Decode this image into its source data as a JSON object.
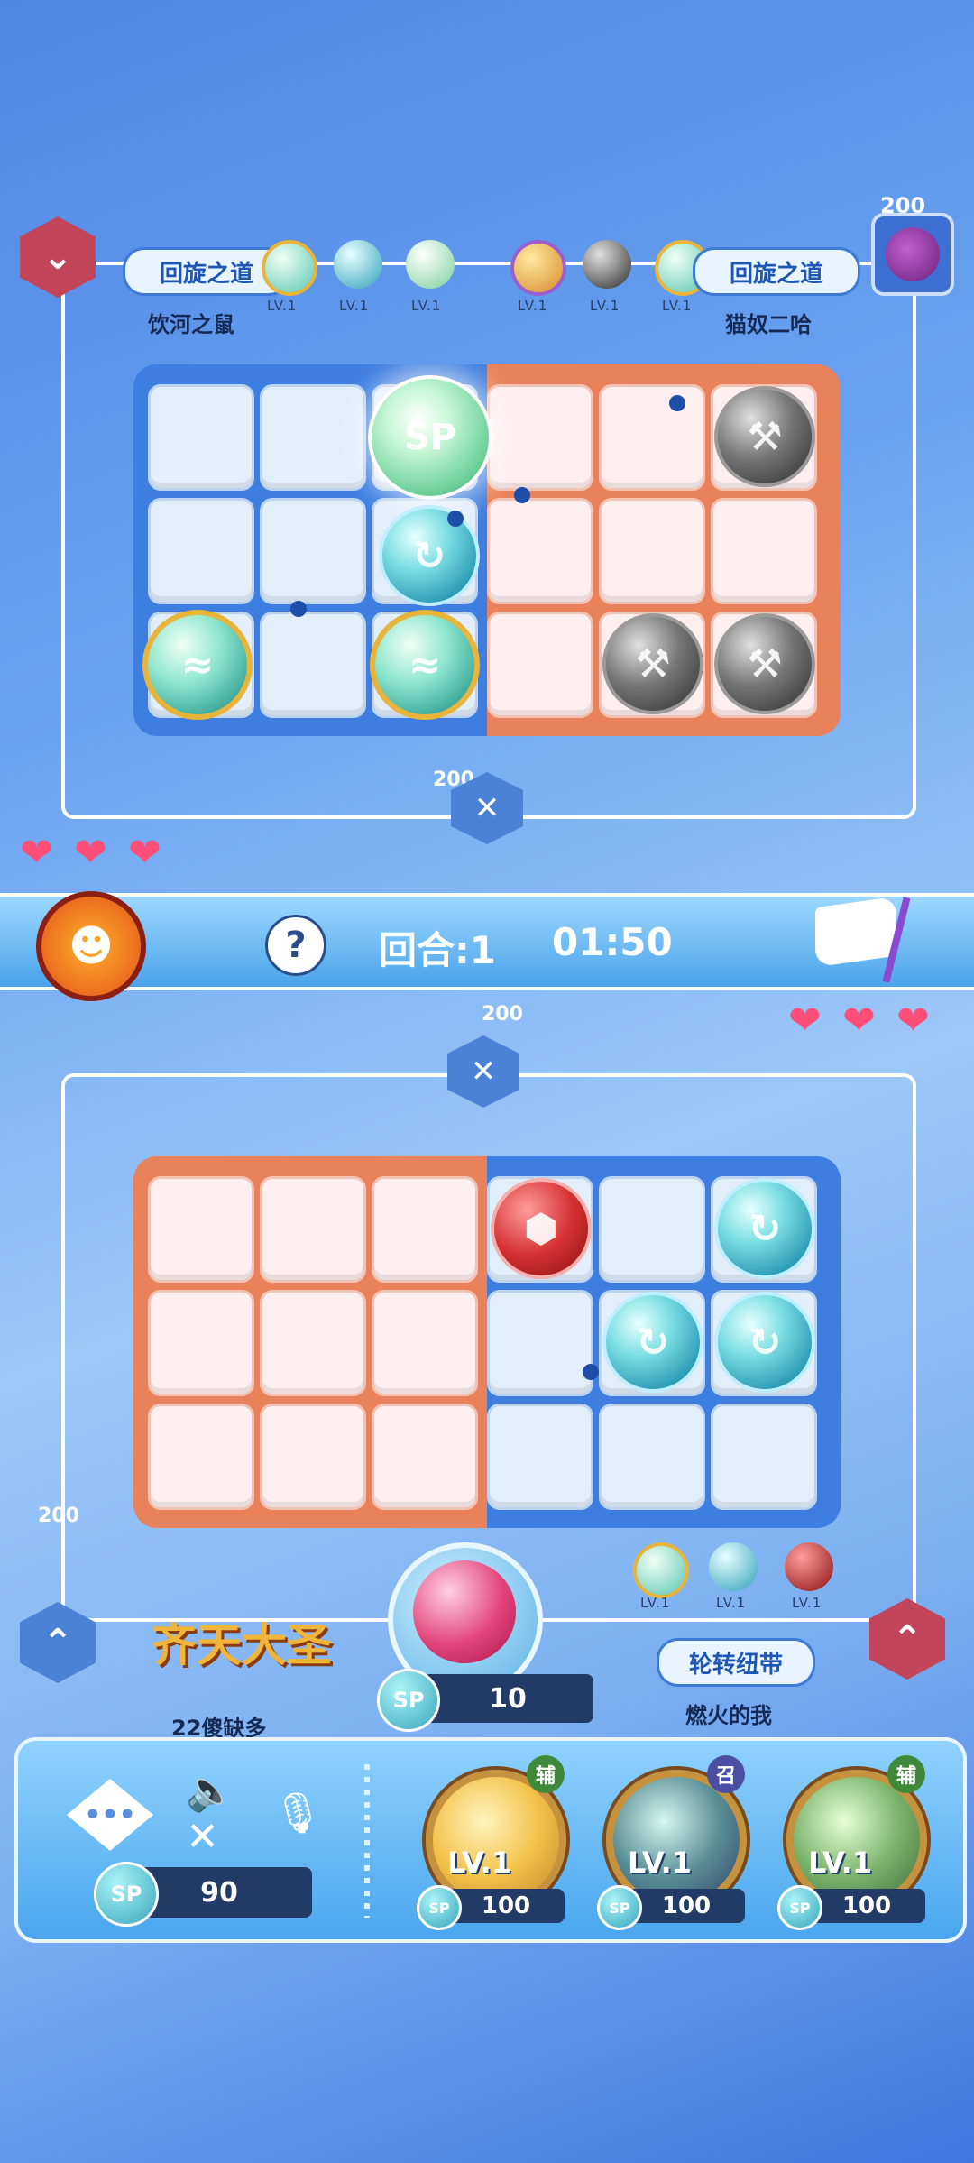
{
  "top": {
    "score": "200",
    "left_player": {
      "title": "回旋之道",
      "name": "饮河之鼠",
      "levels": [
        "LV.1",
        "LV.1",
        "LV.1"
      ]
    },
    "right_player": {
      "title": "回旋之道",
      "name": "猫奴二哈",
      "levels": [
        "LV.1",
        "LV.1",
        "LV.1"
      ]
    },
    "vs_score": "200",
    "hearts": 3
  },
  "status_bar": {
    "round_text": "回合:1",
    "timer": "01:50"
  },
  "bottom": {
    "vs_score": "200",
    "hearts": 3,
    "left_score": "200",
    "left_player": {
      "title": "齐天大圣",
      "name": "22傻缺多"
    },
    "right_player": {
      "title": "轮转纽带",
      "name": "燃火的我",
      "levels": [
        "LV.1",
        "LV.1",
        "LV.1"
      ]
    },
    "center_sp_label": "SP",
    "center_sp_value": "10"
  },
  "controls": {
    "sp_label": "SP",
    "sp_value": "90",
    "skills": [
      {
        "level": "LV.1",
        "sp_label": "SP",
        "cost": "100",
        "tag": "辅",
        "tag_color": "#3f8a3a",
        "color": "#f3c24a"
      },
      {
        "level": "LV.1",
        "sp_label": "SP",
        "cost": "100",
        "tag": "召",
        "tag_color": "#4a4fa3",
        "color": "#5a8f96"
      },
      {
        "level": "LV.1",
        "sp_label": "SP",
        "cost": "100",
        "tag": "辅",
        "tag_color": "#3f8a3a",
        "color": "#7ab36a"
      }
    ]
  },
  "colors": {
    "accent_blue": "#3d7ad6",
    "accent_red": "#c2455a",
    "heart": "#ff4f78"
  }
}
